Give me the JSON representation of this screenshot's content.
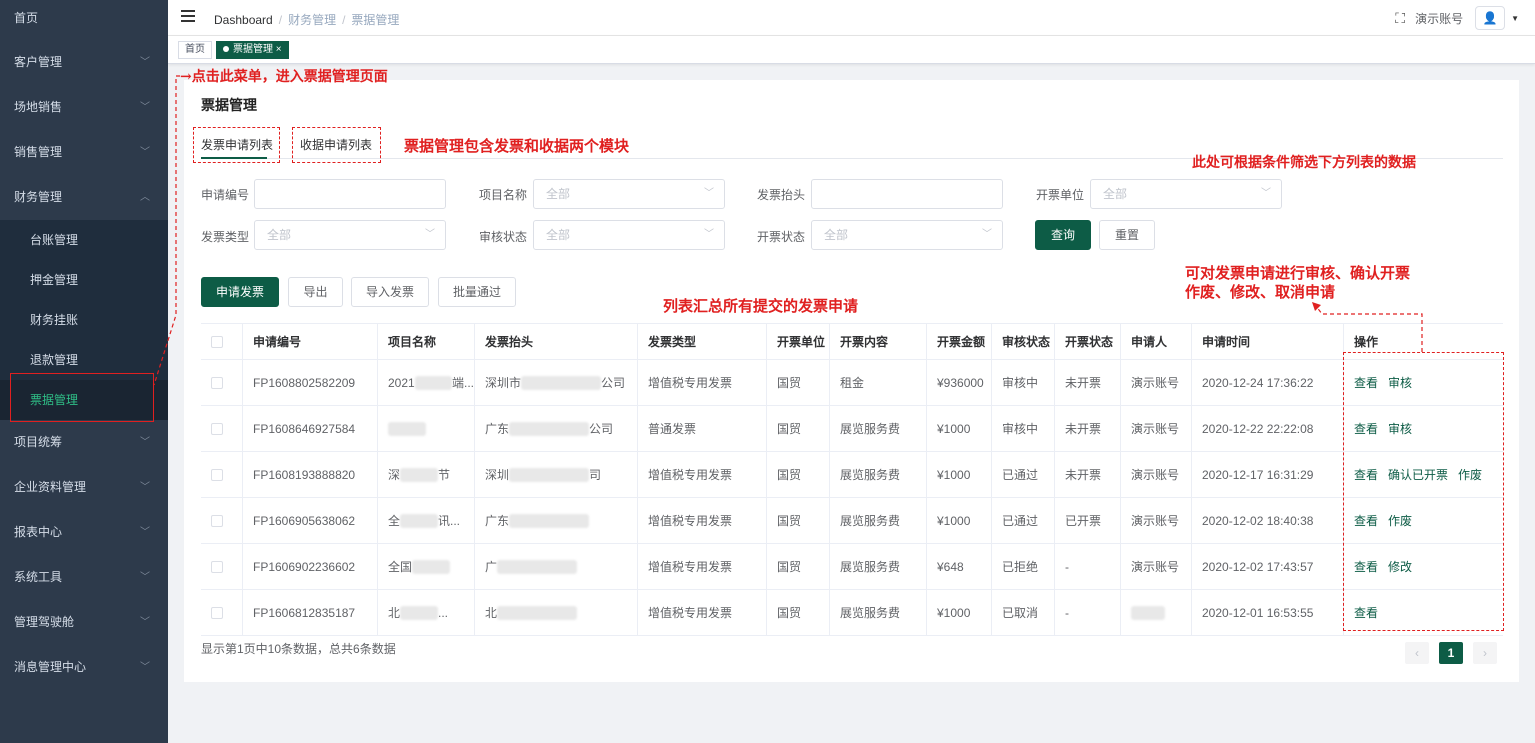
{
  "sidebar": {
    "items": [
      {
        "label": "首页"
      },
      {
        "label": "客户管理"
      },
      {
        "label": "场地销售"
      },
      {
        "label": "销售管理"
      },
      {
        "label": "财务管理"
      }
    ],
    "sub_items": [
      {
        "label": "台账管理"
      },
      {
        "label": "押金管理"
      },
      {
        "label": "财务挂账"
      },
      {
        "label": "退款管理"
      },
      {
        "label": "票据管理"
      }
    ],
    "bottom_items": [
      {
        "label": "项目统筹"
      },
      {
        "label": "企业资料管理"
      },
      {
        "label": "报表中心"
      },
      {
        "label": "系统工具"
      },
      {
        "label": "管理驾驶舱"
      },
      {
        "label": "消息管理中心"
      }
    ]
  },
  "topbar": {
    "breadcrumb": [
      "Dashboard",
      "财务管理",
      "票据管理"
    ],
    "separator": "/",
    "account": "演示账号"
  },
  "tags": {
    "home": "首页",
    "current": "票据管理",
    "close": "×"
  },
  "page": {
    "title": "票据管理",
    "tabs": [
      "发票申请列表",
      "收据申请列表"
    ]
  },
  "filters": {
    "apply_no_label": "申请编号",
    "project_label": "项目名称",
    "project_placeholder": "全部",
    "invoice_title_label": "发票抬头",
    "issuer_label": "开票单位",
    "issuer_placeholder": "全部",
    "invoice_type_label": "发票类型",
    "invoice_type_placeholder": "全部",
    "audit_label": "审核状态",
    "audit_placeholder": "全部",
    "issue_label": "开票状态",
    "issue_placeholder": "全部",
    "query_btn": "查询",
    "reset_btn": "重置"
  },
  "actions": {
    "apply": "申请发票",
    "export": "导出",
    "import": "导入发票",
    "batch": "批量通过"
  },
  "table": {
    "headers": [
      "申请编号",
      "项目名称",
      "发票抬头",
      "发票类型",
      "开票单位",
      "开票内容",
      "开票金额",
      "审核状态",
      "开票状态",
      "申请人",
      "申请时间",
      "操作"
    ],
    "rows": [
      {
        "no": "FP1608802582209",
        "project": "2021",
        "project_tail": "端...",
        "title": "深圳市",
        "title_tail": "公司",
        "type": "增值税专用发票",
        "unit": "国贸",
        "content": "租金",
        "amount": "¥936000",
        "audit": "审核中",
        "issue": "未开票",
        "applicant": "演示账号",
        "time": "2020-12-24 17:36:22",
        "ops": [
          "查看",
          "审核"
        ]
      },
      {
        "no": "FP1608646927584",
        "project": "",
        "project_tail": "",
        "title": "广东",
        "title_tail": "公司",
        "type": "普通发票",
        "unit": "国贸",
        "content": "展览服务费",
        "amount": "¥1000",
        "audit": "审核中",
        "issue": "未开票",
        "applicant": "演示账号",
        "time": "2020-12-22 22:22:08",
        "ops": [
          "查看",
          "审核"
        ]
      },
      {
        "no": "FP1608193888820",
        "project": "深",
        "project_tail": "节",
        "title": "深圳",
        "title_tail": "司",
        "type": "增值税专用发票",
        "unit": "国贸",
        "content": "展览服务费",
        "amount": "¥1000",
        "audit": "已通过",
        "issue": "未开票",
        "applicant": "演示账号",
        "time": "2020-12-17 16:31:29",
        "ops": [
          "查看",
          "确认已开票",
          "作废"
        ]
      },
      {
        "no": "FP1606905638062",
        "project": "全",
        "project_tail": "讯...",
        "title": "广东",
        "title_tail": "",
        "type": "增值税专用发票",
        "unit": "国贸",
        "content": "展览服务费",
        "amount": "¥1000",
        "audit": "已通过",
        "issue": "已开票",
        "applicant": "演示账号",
        "time": "2020-12-02 18:40:38",
        "ops": [
          "查看",
          "作废"
        ]
      },
      {
        "no": "FP1606902236602",
        "project": "全国",
        "project_tail": "",
        "title": "广",
        "title_tail": "",
        "type": "增值税专用发票",
        "unit": "国贸",
        "content": "展览服务费",
        "amount": "¥648",
        "audit": "已拒绝",
        "issue": "-",
        "applicant": "演示账号",
        "time": "2020-12-02 17:43:57",
        "ops": [
          "查看",
          "修改"
        ]
      },
      {
        "no": "FP1606812835187",
        "project": "北",
        "project_tail": "...",
        "title": "北",
        "title_tail": "",
        "type": "增值税专用发票",
        "unit": "国贸",
        "content": "展览服务费",
        "amount": "¥1000",
        "audit": "已取消",
        "issue": "-",
        "applicant": "",
        "time": "2020-12-01 16:53:55",
        "ops": [
          "查看"
        ]
      }
    ]
  },
  "footer": {
    "summary": "显示第1页中10条数据，总共6条数据",
    "prev": "‹",
    "page": "1",
    "next": "›"
  },
  "annotations": {
    "menu_note": "→点击此菜单，进入票据管理页面",
    "tabs_note": "票据管理包含发票和收据两个模块",
    "filter_note": "此处可根据条件筛选下方列表的数据",
    "list_note": "列表汇总所有提交的发票申请",
    "ops_note_1": "可对发票申请进行审核、确认开票",
    "ops_note_2": "作废、修改、取消申请"
  },
  "colors": {
    "sidebar_bg": "#2d3a4b",
    "primary": "#0d5c46",
    "annotation": "#e02020"
  }
}
